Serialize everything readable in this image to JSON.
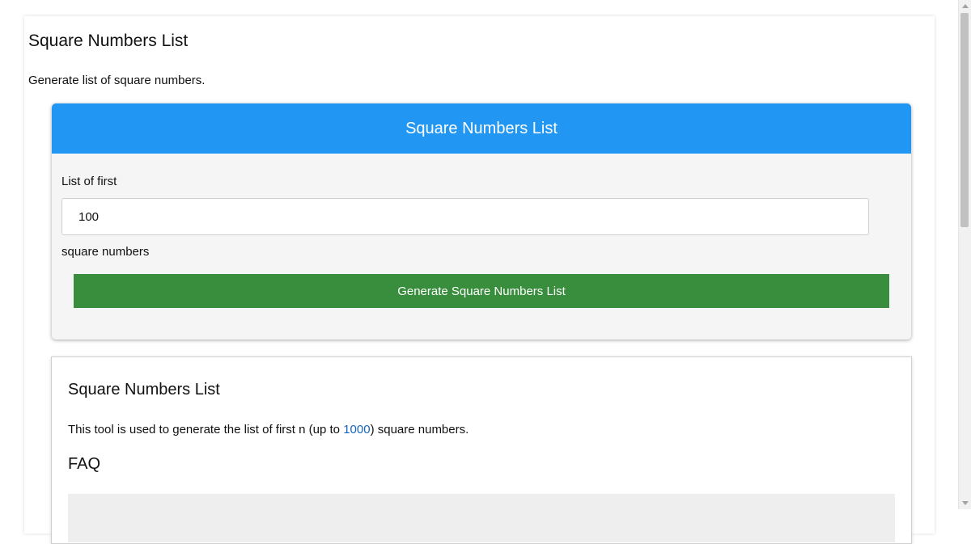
{
  "page": {
    "title": "Square Numbers List",
    "description": "Generate list of square numbers."
  },
  "tool": {
    "header": "Square Numbers List",
    "input_label": "List of first",
    "input_value": "100",
    "input_suffix": "square numbers",
    "generate_label": "Generate Square Numbers List"
  },
  "info": {
    "title": "Square Numbers List",
    "text_before": "This tool is used to generate the list of first n (up to ",
    "link_text": "1000",
    "text_after": ") square numbers.",
    "faq_title": "FAQ"
  },
  "colors": {
    "header_blue": "#2196f3",
    "button_green": "#388e3c",
    "link_blue": "#1565c0"
  }
}
